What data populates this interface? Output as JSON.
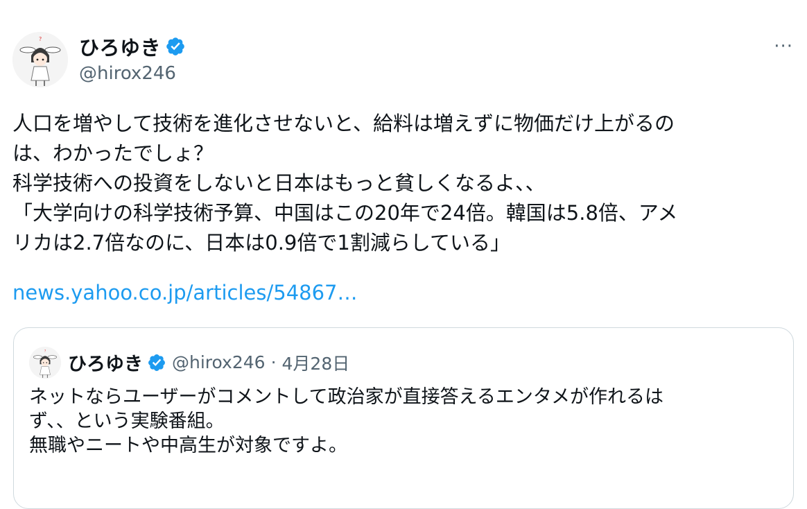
{
  "author": {
    "display_name": "ひろゆき",
    "handle": "@hirox246",
    "verified_icon": "verified-badge-icon",
    "verified_color": "#1d9bf0"
  },
  "more_menu": {
    "label": "···",
    "icon": "more-options-icon"
  },
  "tweet": {
    "lines": [
      "人口を増やして技術を進化させないと、給料は増えずに物価だけ上がるの",
      "は、わかったでしょ？",
      "科学技術への投資をしないと日本はもっと貧しくなるよ、、",
      "「大学向けの科学技術予算、中国はこの20年で24倍。韓国は5.8倍、アメ",
      "リカは2.7倍なのに、日本は0.9倍で1割減らしている」"
    ],
    "link_text": "news.yahoo.co.jp/articles/54867…",
    "link_color": "#1d9bf0"
  },
  "quoted": {
    "display_name": "ひろゆき",
    "handle": "@hirox246",
    "separator": "·",
    "date": "4月28日",
    "lines": [
      "ネットならユーザーがコメントして政治家が直接答えるエンタメが作れるは",
      "ず、、という実験番組。",
      "無職やニートや中高生が対象ですよ。"
    ]
  },
  "colors": {
    "text": "#0f1419",
    "secondary": "#536471",
    "border": "#cfd9de"
  }
}
